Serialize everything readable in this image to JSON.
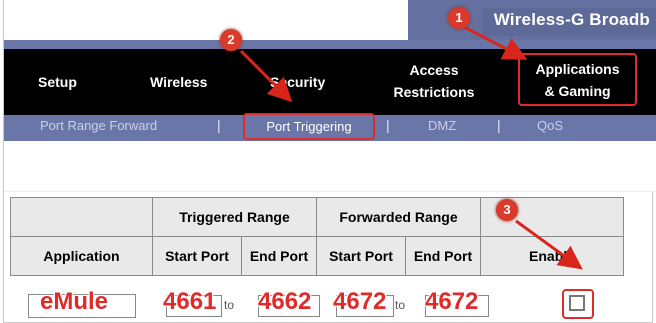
{
  "window": {
    "title": "Wireless-G Broadb"
  },
  "nav": {
    "items": [
      "Setup",
      "Wireless",
      "Security",
      "Access Restrictions",
      "Applications & Gaming"
    ],
    "access_line1": "Access",
    "access_line2": "Restrictions",
    "apps_line1": "Applications",
    "apps_line2": "& Gaming"
  },
  "subnav": {
    "port_range_forward": "Port Range Forward",
    "port_triggering": "Port Triggering",
    "dmz": "DMZ",
    "qos": "QoS",
    "separator": "|"
  },
  "table": {
    "triggered_range": "Triggered Range",
    "forwarded_range": "Forwarded Range",
    "application": "Application",
    "start_port": "Start Port",
    "end_port": "End Port",
    "enable": "Enable",
    "to": "to",
    "row": {
      "application": "eMule",
      "trigger_start": "4661",
      "trigger_end": "4662",
      "forward_start": "4672",
      "forward_end": "4672"
    }
  },
  "annotations": {
    "step1": "1",
    "step2": "2",
    "step3": "3"
  },
  "colors": {
    "accent_blue": "#6b76a8",
    "highlight_red": "#e02b2b",
    "nav_black": "#000000"
  }
}
